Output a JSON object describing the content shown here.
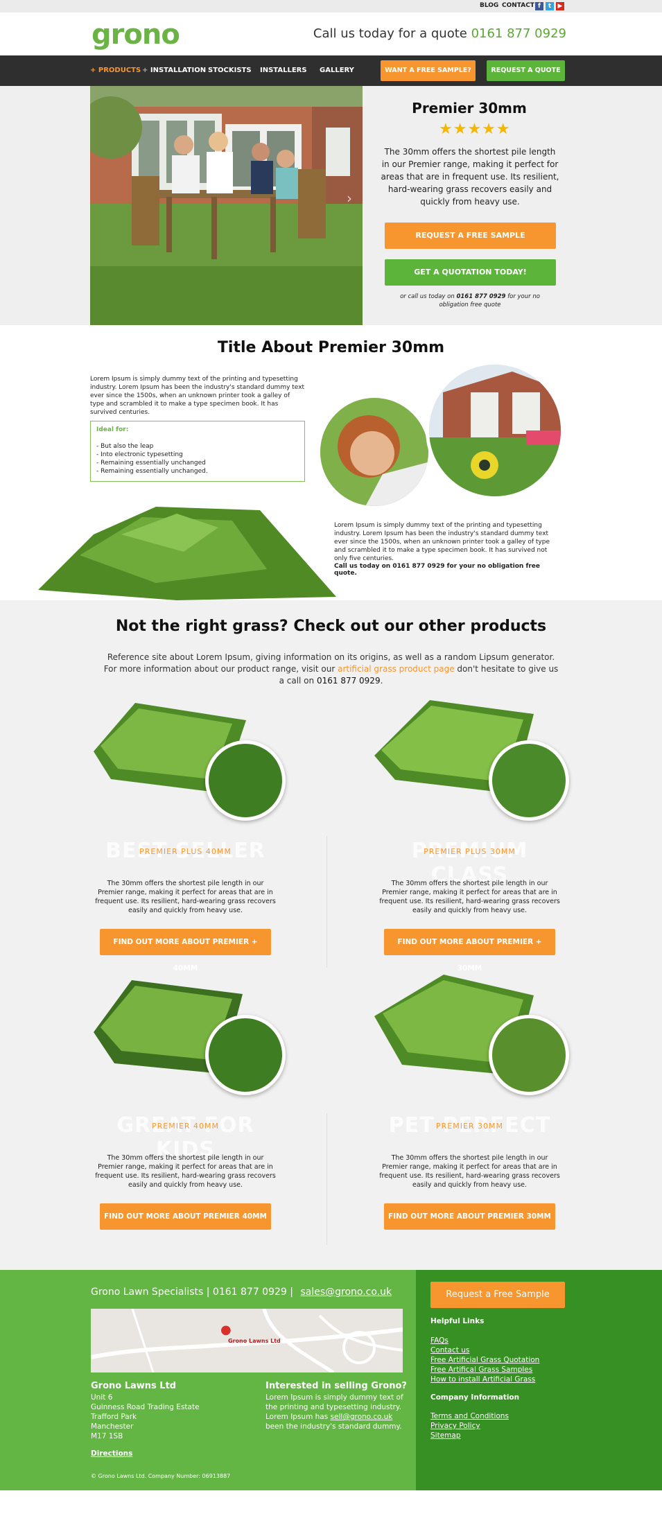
{
  "topbar": {
    "blog": "BLOG",
    "contact": "CONTACT"
  },
  "header": {
    "logo": "grono",
    "call_text": "Call us today for a quote",
    "phone": "0161 877 0929"
  },
  "nav": {
    "items": [
      "PRODUCTS",
      "INSTALLATION",
      "STOCKISTS",
      "INSTALLERS",
      "GALLERY"
    ],
    "sample_btn": "WANT A FREE SAMPLE?",
    "quote_btn": "REQUEST A QUOTE"
  },
  "hero": {
    "title": "Premier 30mm",
    "stars": "★★★★★",
    "desc": "The 30mm offers the shortest pile length in our Premier range, making it perfect for areas that are in frequent use. Its resilient, hard-wearing grass recovers easily and quickly from heavy use.",
    "btn_sample": "REQUEST A FREE SAMPLE",
    "btn_quote": "GET A QUOTATION TODAY!",
    "call_prefix": "or call us today on",
    "call_phone": "0161 877 0929",
    "call_suffix": "for your no obligation free quote"
  },
  "about": {
    "title": "Title About Premier 30mm",
    "para1": "Lorem Ipsum is simply dummy text of the printing and typesetting industry. Lorem Ipsum has been the industry's standard dummy text ever since the 1500s, when an unknown printer took a galley of type and scrambled it to make a type specimen book. It has survived centuries.",
    "ideal_label": "Ideal for:",
    "ideal_items": [
      "- But also the leap",
      "- Into electronic typesetting",
      "- Remaining essentially unchanged",
      "- Remaining essentially unchanged."
    ],
    "para2": "Lorem Ipsum is simply dummy text of the printing and typesetting industry. Lorem Ipsum has been the industry's standard dummy text ever since the 1500s, when an unknown printer took a galley of type and scrambled it to make a type specimen book. It has survived not only five centuries.",
    "call": "Call us today on 0161 877 0929 for your no obligation free quote."
  },
  "products": {
    "title": "Not the right grass? Check out our other products",
    "intro1": "Reference site about Lorem Ipsum, giving information on its origins, as well as a random Lipsum generator.",
    "intro2_a": "For more information about our product range, visit our",
    "intro2_link": "artificial grass product page",
    "intro2_b": "don't hesitate to give us",
    "intro3_a": "a call on",
    "intro3_phone": "0161 877 0929",
    "intro3_b": ".",
    "items": [
      {
        "badge": "BEST SELLER",
        "name": "PREMIER PLUS 40MM",
        "desc": "The 30mm offers the shortest pile length in our Premier range, making it perfect for areas that are in frequent use. Its resilient, hard-wearing grass recovers easily and quickly from heavy use.",
        "btn": "FIND OUT MORE ABOUT PREMIER + 40MM"
      },
      {
        "badge": "PREMIUM CLASS",
        "name": "PREMIER PLUS 30MM",
        "desc": "The 30mm offers the shortest pile length in our Premier range, making it perfect for areas that are in frequent use. Its resilient, hard-wearing grass recovers easily and quickly from heavy use.",
        "btn": "FIND OUT MORE ABOUT PREMIER + 30MM"
      },
      {
        "badge": "GREAT FOR KIDS",
        "name": "PREMIER 40MM",
        "desc": "The 30mm offers the shortest pile length in our Premier range, making it perfect for areas that are in frequent use. Its resilient, hard-wearing grass recovers easily and quickly from heavy use.",
        "btn": "FIND OUT MORE ABOUT PREMIER 40MM"
      },
      {
        "badge": "PET PERFECT",
        "name": "PREMIER 30MM",
        "desc": "The 30mm offers the shortest pile length in our Premier range, making it perfect for areas that are in frequent use. Its resilient, hard-wearing grass recovers easily and quickly from heavy use.",
        "btn": "FIND OUT MORE ABOUT PREMIER 30MM"
      }
    ]
  },
  "footer": {
    "headline": "Grono Lawn Specialists | 0161 877 0929 |",
    "email": "sales@grono.co.uk",
    "map_label": "Grono Lawns Ltd",
    "address_title": "Grono Lawns Ltd",
    "address": [
      "Unit 6",
      "Guinness Road Trading Estate",
      "Trafford Park",
      "Manchester",
      "M17 1SB"
    ],
    "directions": "Directions",
    "copyright": "© Grono Lawns Ltd. Company Number: 06913887",
    "sell_title": "Interested in selling Grono?",
    "sell_text_a": "Lorem Ipsum is simply dummy text of the printing and typesetting industry. Lorem Ipsum has",
    "sell_email": "sell@grono.co.uk",
    "sell_text_b": "been the industry's standard dummy.",
    "sample_btn": "Request a Free Sample",
    "helpful_title": "Helpful Links",
    "helpful": [
      "FAQs",
      "Contact us",
      "Free Artificial Grass Quotation",
      "Free Artifical Grass Samples",
      "How to install Artificial Grass"
    ],
    "company_title": "Company Information",
    "company": [
      "Terms and Conditions",
      "Privacy Policy",
      "Sitemap"
    ]
  },
  "colors": {
    "brand_green": "#6ab344",
    "orange": "#f7962e",
    "nav_dark": "#2f2f2f",
    "footer_green": "#63b544",
    "footer_dark_green": "#379024"
  }
}
